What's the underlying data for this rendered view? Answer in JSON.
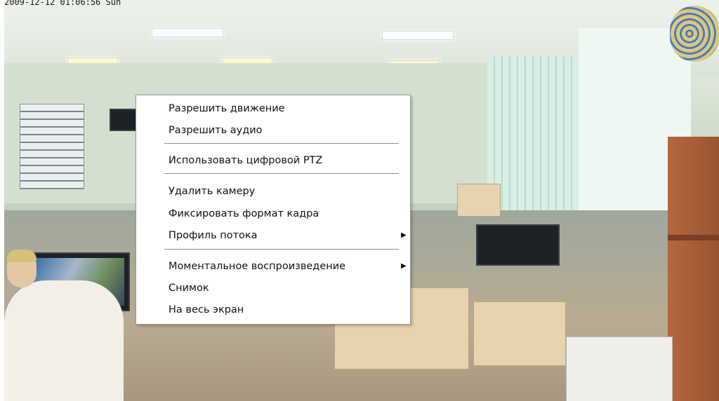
{
  "camera": {
    "timestamp": "2009-12-12 01:06:56 Sun"
  },
  "context_menu": {
    "items": [
      {
        "label": "Разрешить движение",
        "submenu": false
      },
      {
        "label": "Разрешить аудио",
        "submenu": false
      },
      {
        "label": "Использовать цифровой PTZ",
        "submenu": false
      },
      {
        "label": "Удалить камеру",
        "submenu": false
      },
      {
        "label": "Фиксировать формат кадра",
        "submenu": false
      },
      {
        "label": "Профиль потока",
        "submenu": true
      },
      {
        "label": "Моментальное воспроизведение",
        "submenu": true
      },
      {
        "label": "Снимок",
        "submenu": false
      },
      {
        "label": "На весь экран",
        "submenu": false
      }
    ],
    "submenu_arrow_icon": "triangle-right-icon",
    "colors": {
      "background": "#ffffff",
      "text": "#111111",
      "separator": "#8e8e8e"
    }
  }
}
